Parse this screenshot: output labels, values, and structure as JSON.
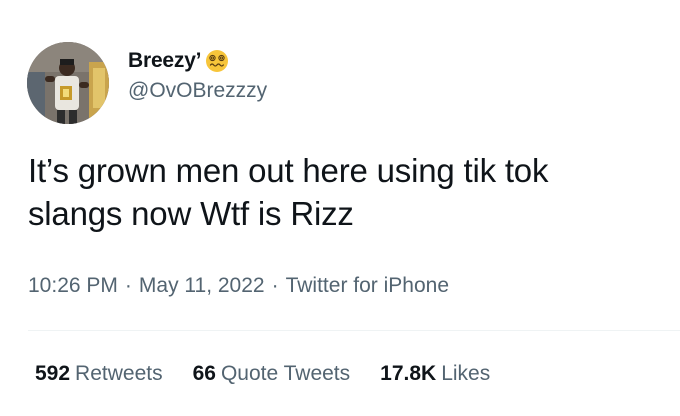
{
  "author": {
    "display_name": "Breezy’",
    "name_emoji": "woozy-face-emoji",
    "handle": "@OvOBrezzzy",
    "avatar": "profile-photo-avatar"
  },
  "tweet": {
    "text": "It’s grown men out here using tik tok\nslangs now Wtf is Rizz"
  },
  "meta": {
    "time": "10:26 PM",
    "separator": "·",
    "date": "May 11, 2022",
    "source": "Twitter for iPhone"
  },
  "stats": {
    "retweets_count": "592",
    "retweets_label": "Retweets",
    "quotes_count": "66",
    "quotes_label": "Quote Tweets",
    "likes_count": "17.8K",
    "likes_label": "Likes"
  },
  "colors": {
    "text_primary": "#0f1419",
    "text_secondary": "#536471",
    "divider": "#eff3f4"
  }
}
